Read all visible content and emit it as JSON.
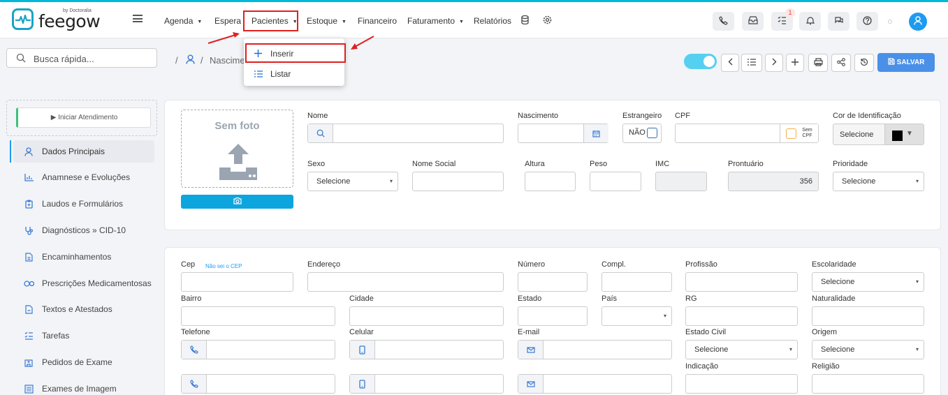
{
  "brand": {
    "name": "feegow",
    "tagline": "by Doctoralia"
  },
  "nav": {
    "items": [
      {
        "label": "Agenda",
        "caret": true
      },
      {
        "label": "Espera",
        "caret": false
      },
      {
        "label": "Pacientes",
        "caret": true
      },
      {
        "label": "Estoque",
        "caret": true
      },
      {
        "label": "Financeiro",
        "caret": false
      },
      {
        "label": "Faturamento",
        "caret": true
      },
      {
        "label": "Relatórios",
        "caret": false
      }
    ],
    "icons": [
      "database-icon",
      "gear-icon"
    ]
  },
  "toolbar_icons": [
    "phone-icon",
    "inbox-icon",
    "tasks-icon",
    "bell-icon",
    "chat-icon",
    "help-icon",
    "user-icon"
  ],
  "notification_count": "1",
  "dropdown": {
    "items": [
      {
        "label": "Inserir",
        "icon": "plus-icon"
      },
      {
        "label": "Listar",
        "icon": "list-icon"
      }
    ]
  },
  "search": {
    "placeholder": "Busca rápida..."
  },
  "start_button": "▶ Iniciar Atendimento",
  "sidebar": {
    "items": [
      {
        "label": "Dados Principais",
        "icon": "user-icon",
        "active": true
      },
      {
        "label": "Anamnese e Evoluções",
        "icon": "chart-icon"
      },
      {
        "label": "Laudos e Formulários",
        "icon": "clipboard-icon"
      },
      {
        "label": "Diagnósticos » CID-10",
        "icon": "stethoscope-icon"
      },
      {
        "label": "Encaminhamentos",
        "icon": "document-icon"
      },
      {
        "label": "Prescrições Medicamentosas",
        "icon": "pills-icon"
      },
      {
        "label": "Textos e Atestados",
        "icon": "file-icon"
      },
      {
        "label": "Tarefas",
        "icon": "checklist-icon"
      },
      {
        "label": "Pedidos de Exame",
        "icon": "hospital-icon"
      },
      {
        "label": "Exames de Imagem",
        "icon": "image-icon"
      }
    ]
  },
  "breadcrumb": {
    "sep": "/",
    "current": "Nascime"
  },
  "actions": {
    "save_label": "SALVAR"
  },
  "photo": {
    "label": "Sem foto"
  },
  "form": {
    "nome": "Nome",
    "nascimento": "Nascimento",
    "estrangeiro": "Estrangeiro",
    "estrangeiro_value": "NÃO",
    "cpf": "CPF",
    "sem_cpf": "Sem CPF",
    "cor": "Cor de Identificação",
    "cor_value": "Selecione",
    "sexo": "Sexo",
    "sexo_value": "Selecione",
    "nome_social": "Nome Social",
    "altura": "Altura",
    "peso": "Peso",
    "imc": "IMC",
    "prontuario": "Prontuário",
    "prontuario_value": "356",
    "prioridade": "Prioridade",
    "prioridade_value": "Selecione",
    "cep": "Cep",
    "cep_help": "Não sei o CEP",
    "endereco": "Endereço",
    "numero": "Número",
    "compl": "Compl.",
    "profissao": "Profissão",
    "escolaridade": "Escolaridade",
    "escolaridade_value": "Selecione",
    "bairro": "Bairro",
    "cidade": "Cidade",
    "estado": "Estado",
    "pais": "País",
    "rg": "RG",
    "naturalidade": "Naturalidade",
    "telefone": "Telefone",
    "celular": "Celular",
    "email": "E-mail",
    "estado_civil": "Estado Civil",
    "estado_civil_value": "Selecione",
    "origem": "Origem",
    "origem_value": "Selecione",
    "indicacao": "Indicação",
    "religiao": "Religião"
  },
  "colors": {
    "accent": "#1e9bf0",
    "highlight": "#e02020",
    "save": "#4a90e8",
    "toggle": "#55d0f0"
  }
}
